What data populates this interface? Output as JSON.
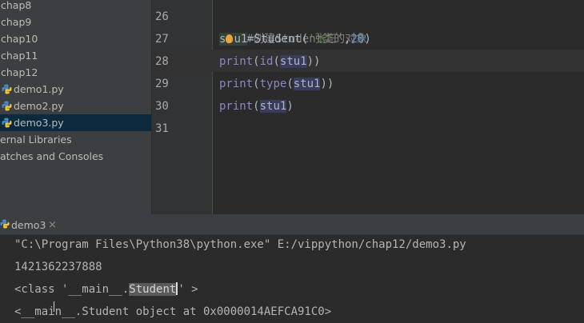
{
  "project_tree": {
    "items": [
      {
        "label": "chap8",
        "type": "folder"
      },
      {
        "label": "chap9",
        "type": "folder"
      },
      {
        "label": "chap10",
        "type": "folder"
      },
      {
        "label": "chap11",
        "type": "folder"
      },
      {
        "label": "chap12",
        "type": "folder"
      },
      {
        "label": "demo1.py",
        "type": "python-file"
      },
      {
        "label": "demo2.py",
        "type": "python-file"
      },
      {
        "label": "demo3.py",
        "type": "python-file",
        "selected": true
      },
      {
        "label": "ernal Libraries",
        "type": "library"
      },
      {
        "label": "atches and Consoles",
        "type": "scratches"
      }
    ]
  },
  "editor": {
    "line_numbers": [
      "26",
      "27",
      "28",
      "29",
      "30",
      "31"
    ],
    "current_line": "28",
    "lines": {
      "l26": {
        "comment": "#创建Student类的对象"
      },
      "l27": {
        "var_a": "s",
        "var_b": "u1",
        "eq": "=",
        "cls": "Student",
        "open": "(",
        "str": "'张三'",
        "comma": ",",
        "num": "20",
        "close": ")"
      },
      "l28": {
        "fn1": "print",
        "p1": "(",
        "fn2": "id",
        "p2": "(",
        "var": "stu1",
        "close": "))"
      },
      "l29": {
        "fn1": "print",
        "p1": "(",
        "fn2": "type",
        "p2": "(",
        "var": "stu1",
        "close": "))"
      },
      "l30": {
        "fn1": "print",
        "p1": "(",
        "var": "stu1",
        "close": ")"
      }
    }
  },
  "run_panel": {
    "tab_label": "demo3",
    "close_glyph": "×",
    "output": {
      "cmd": "\"C:\\Program Files\\Python38\\python.exe\" E:/vippython/chap12/demo3.py",
      "id_value": "1421362237888",
      "type_prefix": "<class '__main__.",
      "type_selected": "Student",
      "type_suffix": "' >",
      "str_value": "<__main__.Student object at 0x0000014AEFCA91C0>"
    }
  },
  "colors": {
    "sidebar_bg": "#3c3f41",
    "editor_bg": "#2b2b2b",
    "selection_bg": "#0d293e",
    "comment": "#808080",
    "builtin": "#8888c6",
    "string": "#6a8759",
    "number": "#6897bb"
  }
}
